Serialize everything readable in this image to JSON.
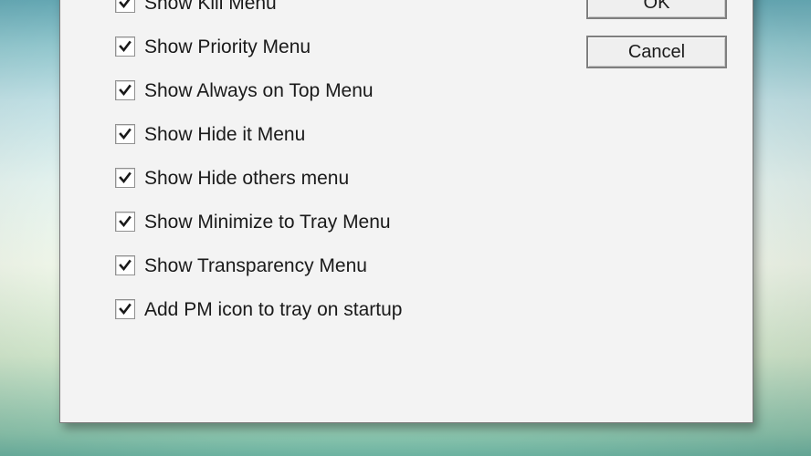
{
  "options": [
    {
      "label": "Show Kill Menu",
      "checked": true
    },
    {
      "label": "Show Priority Menu",
      "checked": true
    },
    {
      "label": "Show Always on Top Menu",
      "checked": true
    },
    {
      "label": "Show Hide it Menu",
      "checked": true
    },
    {
      "label": "Show Hide others menu",
      "checked": true
    },
    {
      "label": "Show Minimize to Tray Menu",
      "checked": true
    },
    {
      "label": "Show Transparency Menu",
      "checked": true
    },
    {
      "label": "Add PM icon to tray on startup",
      "checked": true
    }
  ],
  "buttons": {
    "ok_label": "OK",
    "cancel_label": "Cancel"
  }
}
